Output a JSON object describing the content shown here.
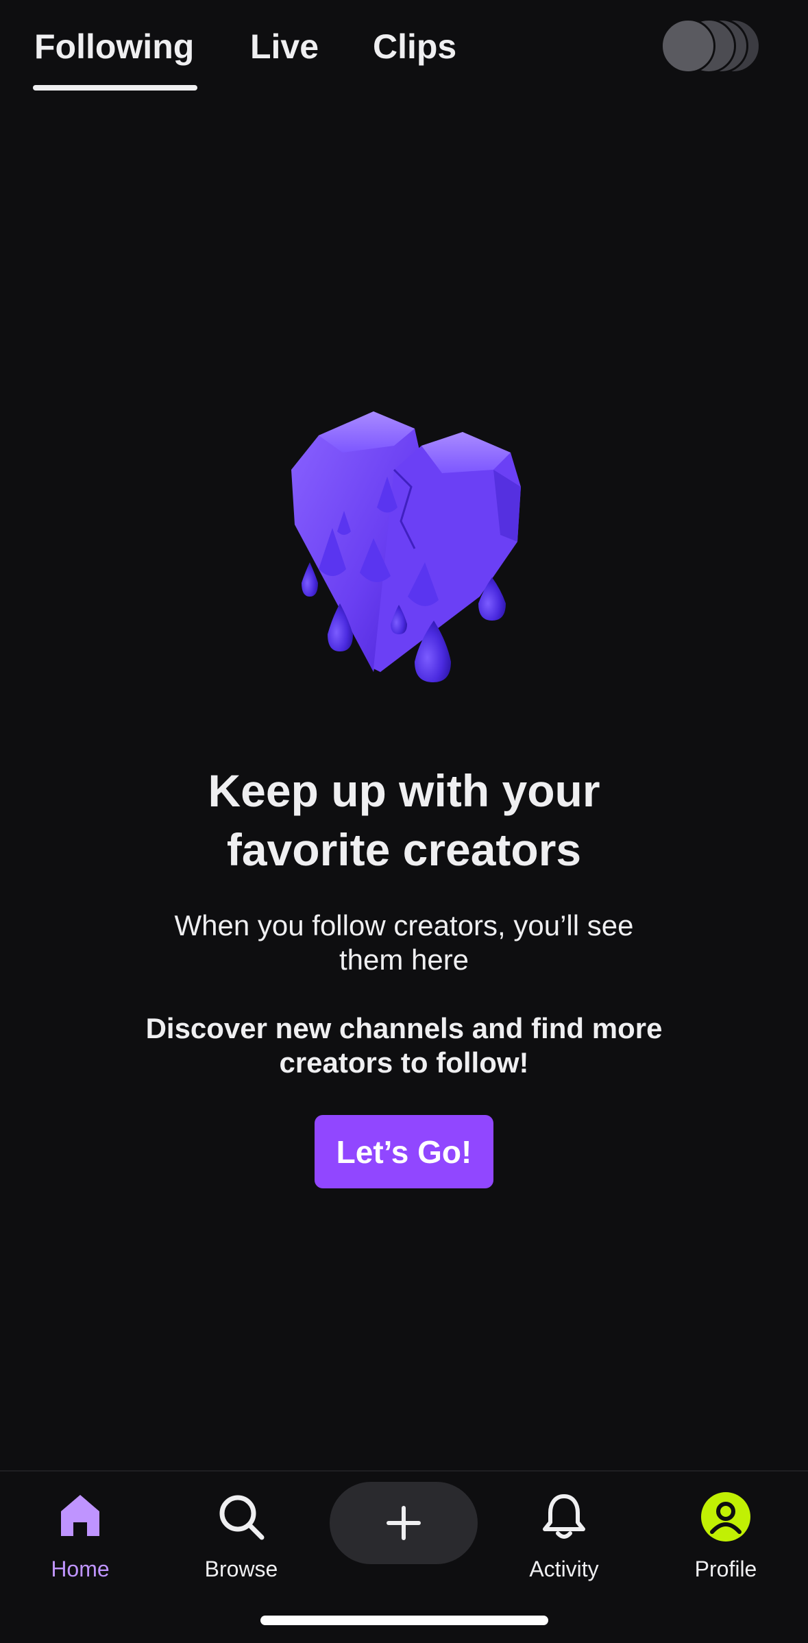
{
  "top_tabs": {
    "items": [
      {
        "label": "Following",
        "active": true
      },
      {
        "label": "Live",
        "active": false
      },
      {
        "label": "Clips",
        "active": false
      }
    ]
  },
  "header": {
    "avatar_stack_icon": "stacked-avatars-icon"
  },
  "empty_state": {
    "illustration_icon": "broken-heart-dripping-icon",
    "headline_line1": "Keep up with your",
    "headline_line2": "favorite creators",
    "subtext_line1": "When you follow creators, you’ll see",
    "subtext_line2": "them here",
    "discover_line1": "Discover new channels and find more",
    "discover_line2": "creators to follow!",
    "cta_label": "Let’s Go!"
  },
  "bottom_nav": {
    "items": [
      {
        "label": "Home",
        "icon": "home-icon",
        "active": true
      },
      {
        "label": "Browse",
        "icon": "search-icon",
        "active": false
      },
      {
        "label": "Activity",
        "icon": "bell-icon",
        "active": false
      },
      {
        "label": "Profile",
        "icon": "profile-avatar-icon",
        "active": false
      }
    ],
    "create_icon": "plus-icon"
  },
  "colors": {
    "background": "#0e0e10",
    "accent": "#9147ff",
    "active_nav": "#bf94ff",
    "profile_avatar": "#c1f004"
  }
}
